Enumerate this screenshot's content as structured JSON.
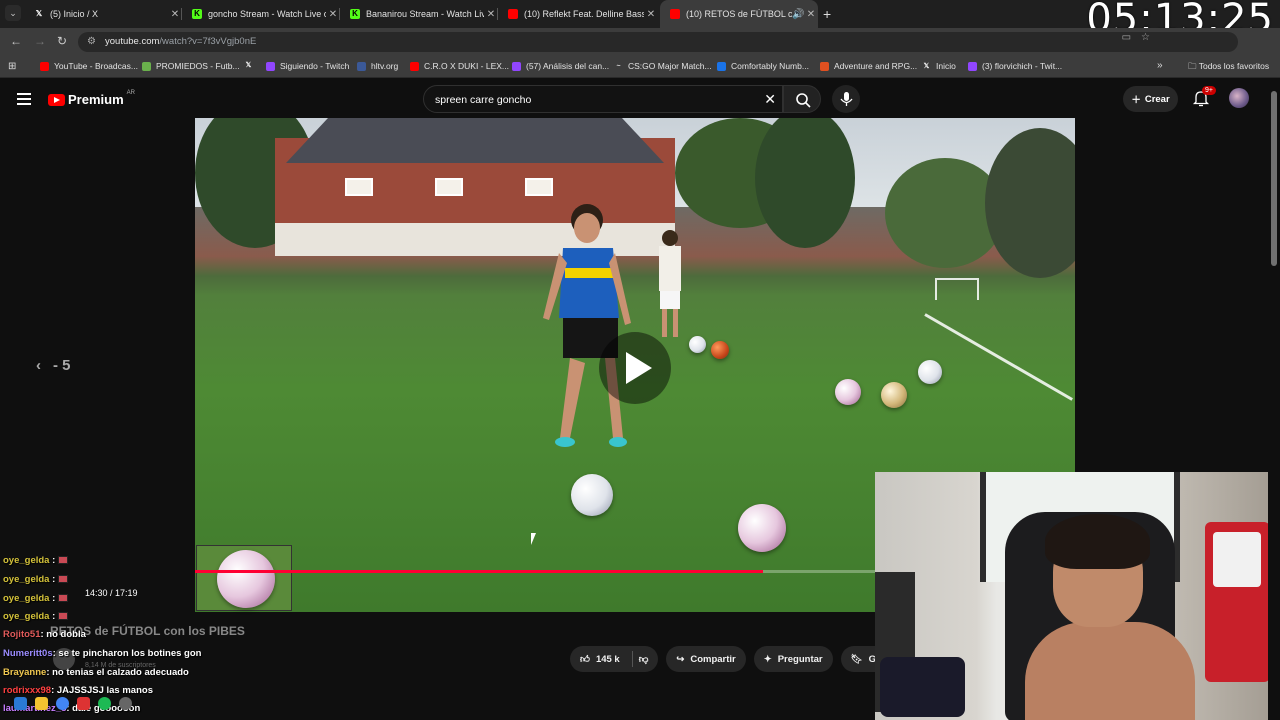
{
  "overlay_clock": "05:13:25",
  "tabs": [
    {
      "title": "(5) Inicio / X",
      "icon": "x-icon"
    },
    {
      "title": "goncho Stream - Watch Live on",
      "icon": "kick-icon"
    },
    {
      "title": "Bananirou Stream - Watch Live",
      "icon": "kick-icon"
    },
    {
      "title": "(10) Reflekt Feat. Delline Bass -",
      "icon": "youtube-icon"
    },
    {
      "title": "(10) RETOS de FÚTBOL con",
      "icon": "youtube-icon",
      "active": true
    }
  ],
  "address": {
    "host": "youtube.com",
    "path": "/watch?v=7f3vVgjb0nE"
  },
  "bookmarks": [
    {
      "label": "YouTube - Broadcas...",
      "icon": "youtube-icon"
    },
    {
      "label": "PROMIEDOS - Futb...",
      "icon": "promiedos-icon"
    },
    {
      "label": "",
      "icon": "x-icon"
    },
    {
      "label": "Siguiendo - Twitch",
      "icon": "twitch-icon"
    },
    {
      "label": "hltv.org",
      "icon": "hltv-icon"
    },
    {
      "label": "C.R.O X DUKI - LEX...",
      "icon": "youtube-icon"
    },
    {
      "label": "(57) Análisis del can...",
      "icon": "twitch-icon"
    },
    {
      "label": "CS:GO Major Match...",
      "icon": "csgo-icon"
    },
    {
      "label": "Comfortably Numb...",
      "icon": "doc-icon"
    },
    {
      "label": "Adventure and RPG...",
      "icon": "game-icon"
    },
    {
      "label": "Inicio",
      "icon": "x-icon"
    },
    {
      "label": "(3) florvichich - Twit...",
      "icon": "twitch-icon"
    }
  ],
  "bookmarks_all": "Todos los favoritos",
  "yt": {
    "logo_word": "Premium",
    "country": "AR",
    "search_query": "spreen carre goncho",
    "create_label": "Crear",
    "notif_count": "9+"
  },
  "player": {
    "seek_label": "- 5",
    "time": "14:30 / 17:19",
    "progress": 0.835
  },
  "video": {
    "title": "RETOS de FÚTBOL con los PIBES",
    "subs": "8,14 M de suscriptores",
    "likes": "145 k",
    "share": "Compartir",
    "ask": "Preguntar",
    "save": "Gu"
  },
  "chat": [
    {
      "user": "oye_gelda",
      "msg": "",
      "color": "#d4c23a"
    },
    {
      "user": "oye_gelda",
      "msg": "",
      "color": "#d4c23a"
    },
    {
      "user": "oye_gelda",
      "msg": "",
      "color": "#d4c23a"
    },
    {
      "user": "oye_gelda",
      "msg": "",
      "color": "#d4c23a"
    },
    {
      "user": "Rojito51",
      "msg": ": no dobla",
      "color": "#e05a5a"
    },
    {
      "user": "Numeritt0s",
      "msg": ": se te pincharon los botines gon",
      "color": "#9b8cff"
    },
    {
      "user": "Brayanne",
      "msg": ": no tenias el calzado adecuado",
      "color": "#f0c850"
    },
    {
      "user": "rodrixxx98",
      "msg": ": JAJSSJSJ las manos",
      "color": "#ff4040"
    },
    {
      "user": "laumartinez_8",
      "msg": ": dale goooooon",
      "color": "#c77dff"
    }
  ],
  "colors": {
    "accent": "#ff0033",
    "yt_red": "#ff0000"
  }
}
